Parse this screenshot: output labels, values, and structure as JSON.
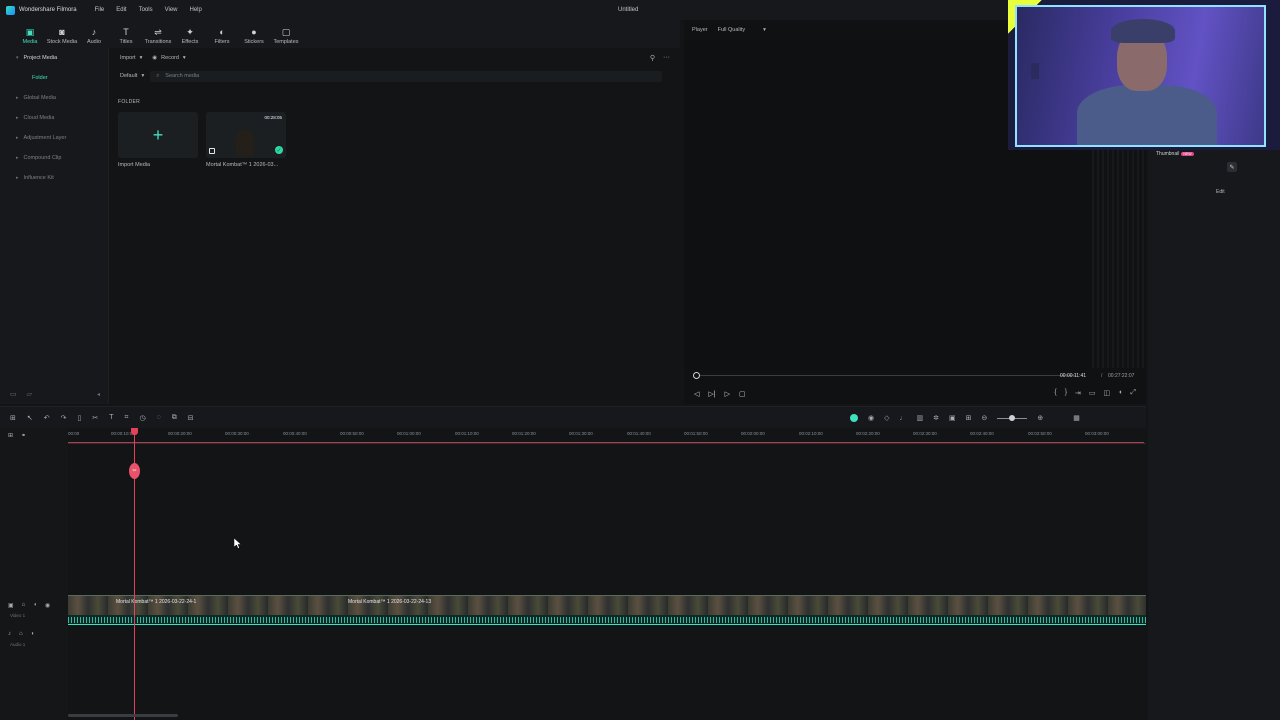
{
  "window": {
    "app_name": "Wondershare Filmora",
    "doc_title": "Untitled"
  },
  "menu": [
    "File",
    "Edit",
    "Tools",
    "View",
    "Help"
  ],
  "toolbar": [
    {
      "label": "Media",
      "icon": "media-icon",
      "active": true
    },
    {
      "label": "Stock Media",
      "icon": "stock-media-icon",
      "active": false
    },
    {
      "label": "Audio",
      "icon": "music-note-icon",
      "active": false
    },
    {
      "label": "Titles",
      "icon": "text-t-icon",
      "active": false
    },
    {
      "label": "Transitions",
      "icon": "transitions-icon",
      "active": false
    },
    {
      "label": "Effects",
      "icon": "effects-icon",
      "active": false
    },
    {
      "label": "Filters",
      "icon": "filters-icon",
      "active": false
    },
    {
      "label": "Stickers",
      "icon": "stickers-icon",
      "active": false
    },
    {
      "label": "Templates",
      "icon": "templates-icon",
      "active": false
    }
  ],
  "sidebar": {
    "items": [
      {
        "label": "Project Media",
        "active": true
      },
      {
        "label": "Folder",
        "sub": true
      },
      {
        "label": "Global Media"
      },
      {
        "label": "Cloud Media"
      },
      {
        "label": "Adjustment Layer"
      },
      {
        "label": "Compound Clip"
      },
      {
        "label": "Influence Kit"
      }
    ]
  },
  "media": {
    "import_label": "Import",
    "record_label": "Record",
    "sort_label": "Default",
    "search_placeholder": "Search media",
    "folder_heading": "FOLDER",
    "import_card_label": "Import Media",
    "clip_card_label": "Mortal Kombat™ 1  2026-03...",
    "clip_duration": "00:28:05"
  },
  "player": {
    "label": "Player",
    "quality": "Full Quality",
    "current_time": "00:00:11:41",
    "separator": "/",
    "total_time": "00:27:22:07"
  },
  "properties": {
    "thumbnail_label": "Thumbnail",
    "new_badge": "NEW",
    "edit_label": "Edit"
  },
  "timeline": {
    "ticks": [
      "00:00",
      "00:00:10:00",
      "00:00:20:00",
      "00:00:30:00",
      "00:00:40:00",
      "00:00:50:00",
      "00:01:00:00",
      "00:01:10:00",
      "00:01:20:00",
      "00:01:30:00",
      "00:01:40:00",
      "00:01:50:00",
      "00:02:00:00",
      "00:02:10:00",
      "00:02:20:00",
      "00:02:30:00",
      "00:02:40:00",
      "00:02:50:00",
      "00:03:00:00"
    ],
    "clip1_label": "Mortal Kombat™ 1  2026-03-22-24-1",
    "clip2_label": "Mortal Kombat™ 1  2026-03-22-24-13",
    "video_track_label": "Video 1",
    "audio_track_label": "Audio 1"
  },
  "colors": {
    "accent": "#3ee0c1",
    "playhead": "#e2425a"
  }
}
